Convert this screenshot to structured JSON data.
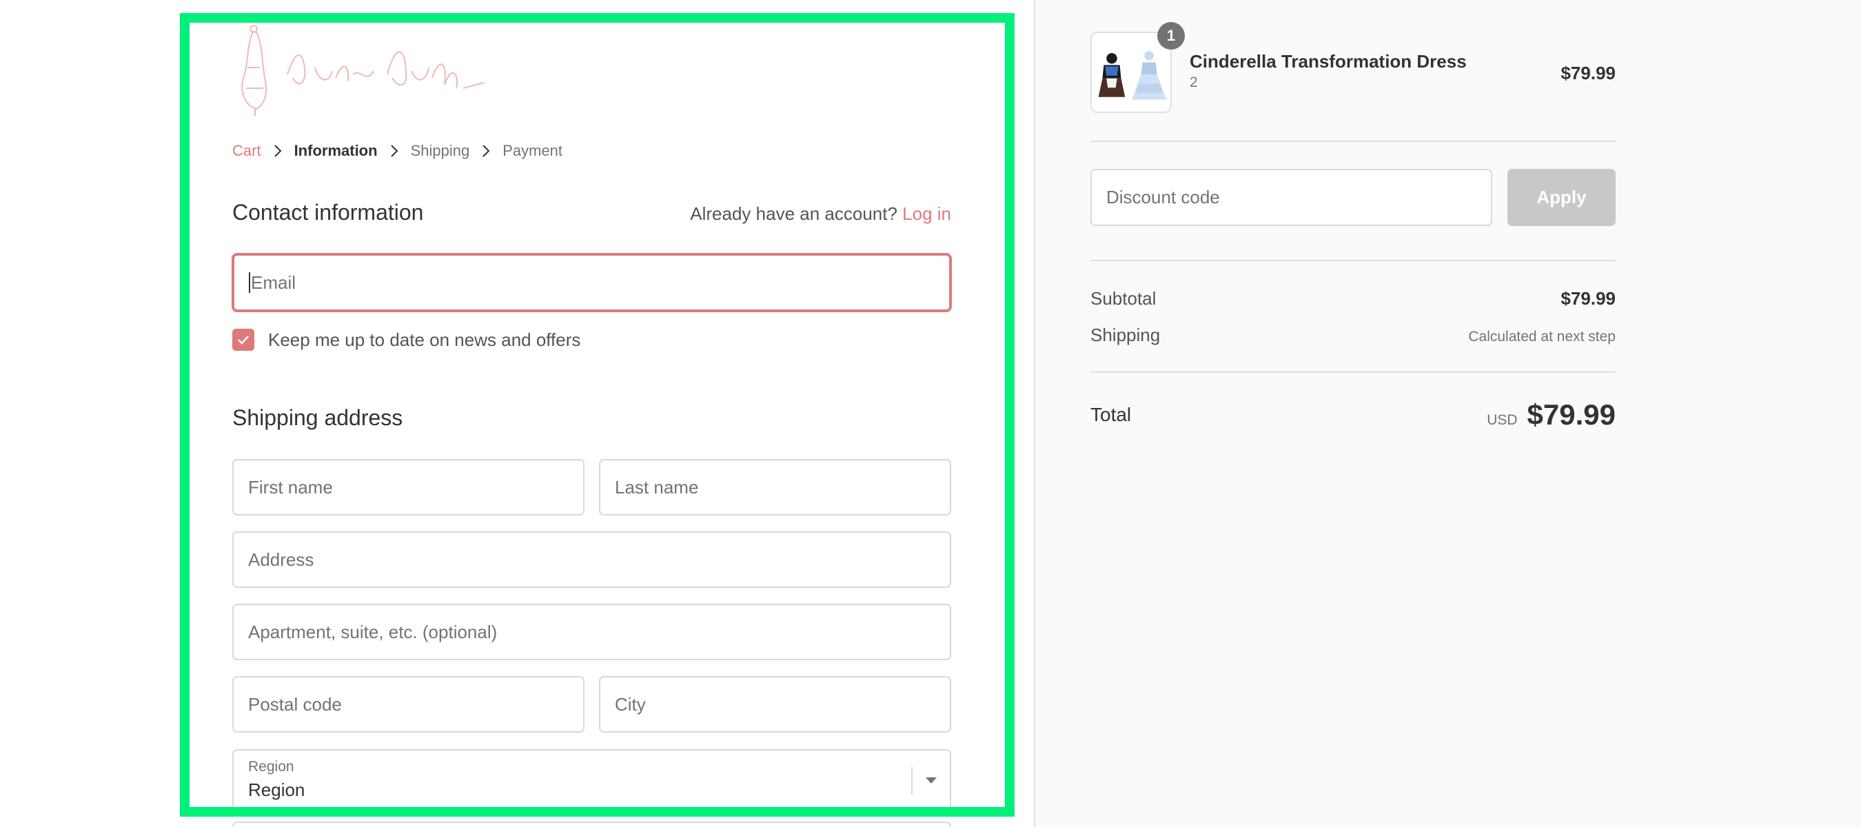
{
  "breadcrumb": {
    "items": [
      {
        "label": "Cart"
      },
      {
        "label": "Information"
      },
      {
        "label": "Shipping"
      },
      {
        "label": "Payment"
      }
    ]
  },
  "contact": {
    "title": "Contact information",
    "account_prompt": "Already have an account?",
    "login_label": "Log in",
    "email_placeholder": "Email",
    "newsletter_label": "Keep me up to date on news and offers",
    "newsletter_checked": true
  },
  "shipping": {
    "title": "Shipping address",
    "first_name_placeholder": "First name",
    "last_name_placeholder": "Last name",
    "address_placeholder": "Address",
    "apartment_placeholder": "Apartment, suite, etc. (optional)",
    "postal_placeholder": "Postal code",
    "city_placeholder": "City",
    "region_label": "Region",
    "region_value": "Region"
  },
  "order": {
    "product_name": "Cinderella Transformation Dress",
    "product_variant": "2",
    "quantity": "1",
    "product_price": "$79.99",
    "discount_placeholder": "Discount code",
    "apply_label": "Apply",
    "subtotal_label": "Subtotal",
    "subtotal_value": "$79.99",
    "shipping_label": "Shipping",
    "shipping_value": "Calculated at next step",
    "total_label": "Total",
    "currency": "USD",
    "total_value": "$79.99"
  },
  "colors": {
    "accent": "#e07a7a",
    "highlight": "#00f07a",
    "button_disabled": "#c8c8c8",
    "sidebar_bg": "#fafafa"
  }
}
